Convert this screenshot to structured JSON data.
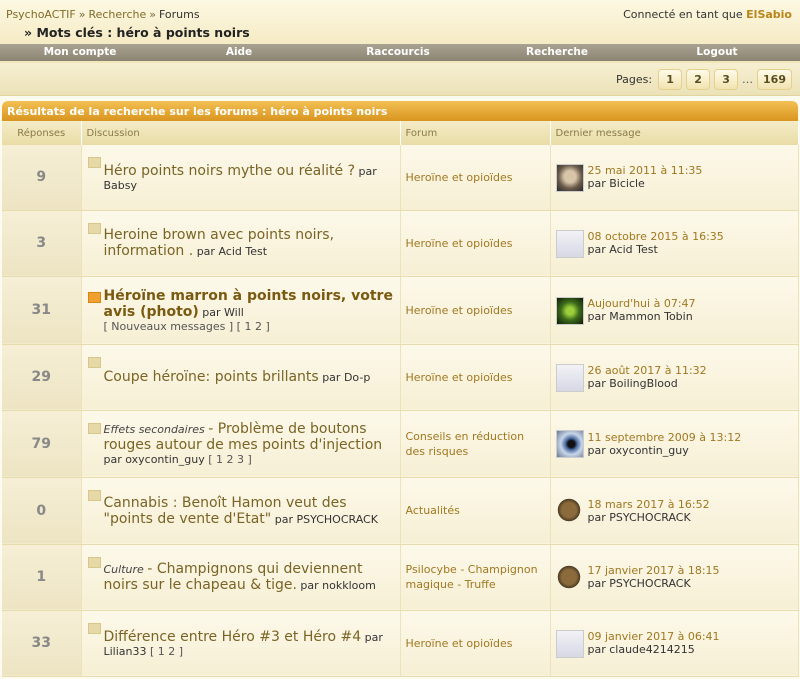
{
  "breadcrumb": {
    "home": "PsychoACTIF",
    "sep": "»",
    "search": "Recherche",
    "current": "Forums"
  },
  "user": {
    "prefix": "Connecté en tant que",
    "name": "ElSabio"
  },
  "keywords": {
    "marker": "»",
    "text": "Mots clés : héro à points noirs"
  },
  "menu": [
    "Mon compte",
    "Aide",
    "Raccourcis",
    "Recherche",
    "Logout"
  ],
  "pager": {
    "label": "Pages:",
    "pages": [
      "1",
      "2",
      "3"
    ],
    "ellipsis": "…",
    "last": "169"
  },
  "results_title": "Résultats de la recherche sur les forums : héro à points noirs",
  "columns": {
    "replies": "Réponses",
    "discussion": "Discussion",
    "forum": "Forum",
    "last": "Dernier message"
  },
  "topics": [
    {
      "replies": "9",
      "cat": "",
      "title": "Héro points noirs mythe ou réalité ?",
      "by": "par Babsy",
      "extra": "",
      "pages": "",
      "forum": "Heroïne et opioïdes",
      "last_date": "25 mai 2011 à  11:35",
      "last_by": "par Bicicle",
      "avatar": "photo",
      "icon": "normal"
    },
    {
      "replies": "3",
      "cat": "",
      "title": "Heroine brown avec points noirs, information .",
      "by": "par Acid Test",
      "extra": "",
      "pages": "",
      "forum": "Heroïne et opioïdes",
      "last_date": "08 octobre 2015 à  16:35",
      "last_by": "par Acid Test",
      "avatar": "default",
      "icon": "normal"
    },
    {
      "replies": "31",
      "cat": "",
      "title": "Héroïne marron à points noirs, votre avis (photo)",
      "by": "par Will",
      "extra": "[ Nouveaux messages ] [ 1 2 ]",
      "pages": "",
      "forum": "Heroïne et opioïdes",
      "last_date": "Aujourd'hui à  07:47",
      "last_by": "par Mammon Tobin",
      "avatar": "green",
      "icon": "hot"
    },
    {
      "replies": "29",
      "cat": "",
      "title": "Coupe héroïne: points brillants",
      "by": "par Do-p",
      "extra": "",
      "pages": "",
      "forum": "Heroïne et opioïdes",
      "last_date": "26 août 2017 à  11:32",
      "last_by": "par BoilingBlood",
      "avatar": "default",
      "icon": "normal"
    },
    {
      "replies": "79",
      "cat": "Effets secondaires",
      "title": "Problème de boutons rouges autour de mes points d'injection",
      "by": "par oxycontin_guy",
      "extra": "",
      "pages": "[ 1 2 3 ]",
      "forum": "Conseils en réduction des risques",
      "last_date": "11 septembre 2009 à  13:12",
      "last_by": "par oxycontin_guy",
      "avatar": "eye",
      "icon": "normal"
    },
    {
      "replies": "0",
      "cat": "",
      "title": "Cannabis : Benoît Hamon veut des \"points de vente d'Etat\"",
      "by": "par PSYCHOCRACK",
      "extra": "",
      "pages": "",
      "forum": "Actualités",
      "last_date": "18 mars 2017 à  16:52",
      "last_by": "par PSYCHOCRACK",
      "avatar": "cap",
      "icon": "normal"
    },
    {
      "replies": "1",
      "cat": "Culture",
      "title": "Champignons qui deviennent noirs sur le chapeau & tige.",
      "by": "par nokkloom",
      "extra": "",
      "pages": "",
      "forum": "Psilocybe - Champignon magique - Truffe",
      "last_date": "17 janvier 2017 à  18:15",
      "last_by": "par PSYCHOCRACK",
      "avatar": "cap",
      "icon": "normal"
    },
    {
      "replies": "33",
      "cat": "",
      "title": "Différence entre Héro #3 et Héro #4",
      "by": "par Lilian33",
      "extra": "",
      "pages": "[ 1 2 ]",
      "forum": "Heroïne et opioïdes",
      "last_date": "09 janvier 2017 à  06:41",
      "last_by": "par claude4214215",
      "avatar": "default",
      "icon": "normal"
    }
  ]
}
